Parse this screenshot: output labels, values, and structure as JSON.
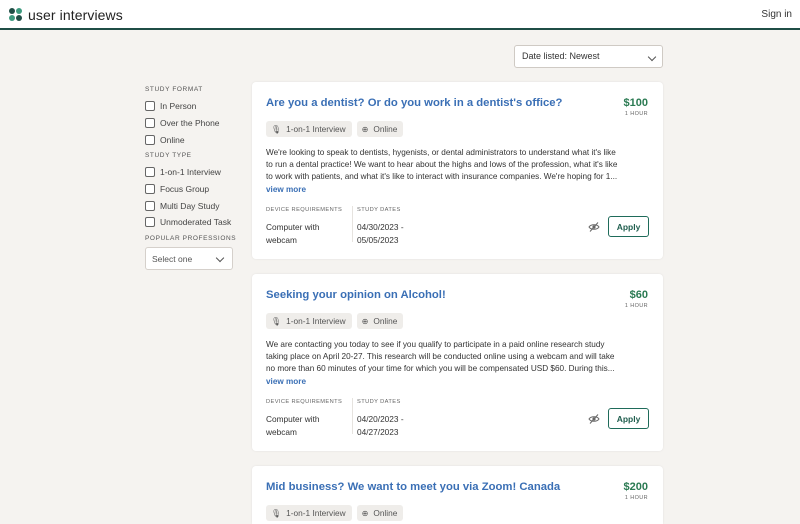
{
  "header": {
    "logo_text": "user interviews",
    "signin_label": "Sign in"
  },
  "sort": {
    "selected": "Date listed: Newest"
  },
  "filters": {
    "study_format_title": "STUDY FORMAT",
    "study_format": [
      "In Person",
      "Over the Phone",
      "Online"
    ],
    "study_type_title": "STUDY TYPE",
    "study_type": [
      "1-on-1 Interview",
      "Focus Group",
      "Multi Day Study",
      "Unmoderated Task"
    ],
    "professions_title": "POPULAR PROFESSIONS",
    "professions_selected": "Select one"
  },
  "labels": {
    "view_more": "view more",
    "device_req": "DEVICE REQUIREMENTS",
    "study_dates": "STUDY DATES",
    "apply": "Apply",
    "per": "1 HOUR"
  },
  "studies": [
    {
      "title": "Are you a dentist? Or do you work in a dentist's office?",
      "price": "$100",
      "tags": [
        "1-on-1 Interview",
        "Online"
      ],
      "desc_lines": [
        "We're looking to speak to dentists, hygenists, or dental administrators to understand what it's like",
        "to run a dental practice! We want to hear about the highs and lows of the profession, what it's like",
        "to work with patients, and what it's like to interact with insurance companies. We're hoping for 1..."
      ],
      "device_lines": [
        "Computer with",
        "webcam"
      ],
      "date_lines": [
        "04/30/2023 -",
        "05/05/2023"
      ]
    },
    {
      "title": "Seeking your opinion on Alcohol!",
      "price": "$60",
      "tags": [
        "1-on-1 Interview",
        "Online"
      ],
      "desc_lines": [
        "We are contacting you today to see if you qualify to participate in a paid online research study",
        "taking place on April 20-27. This research will be conducted online using a webcam and will take",
        "no more than 60 minutes of your time for which you will be compensated USD $60. During this..."
      ],
      "device_lines": [
        "Computer with",
        "webcam"
      ],
      "date_lines": [
        "04/20/2023 -",
        "04/27/2023"
      ]
    },
    {
      "title": "Mid business? We want to meet you via Zoom! Canada",
      "price": "$200",
      "tags": [
        "1-on-1 Interview",
        "Online"
      ]
    }
  ]
}
